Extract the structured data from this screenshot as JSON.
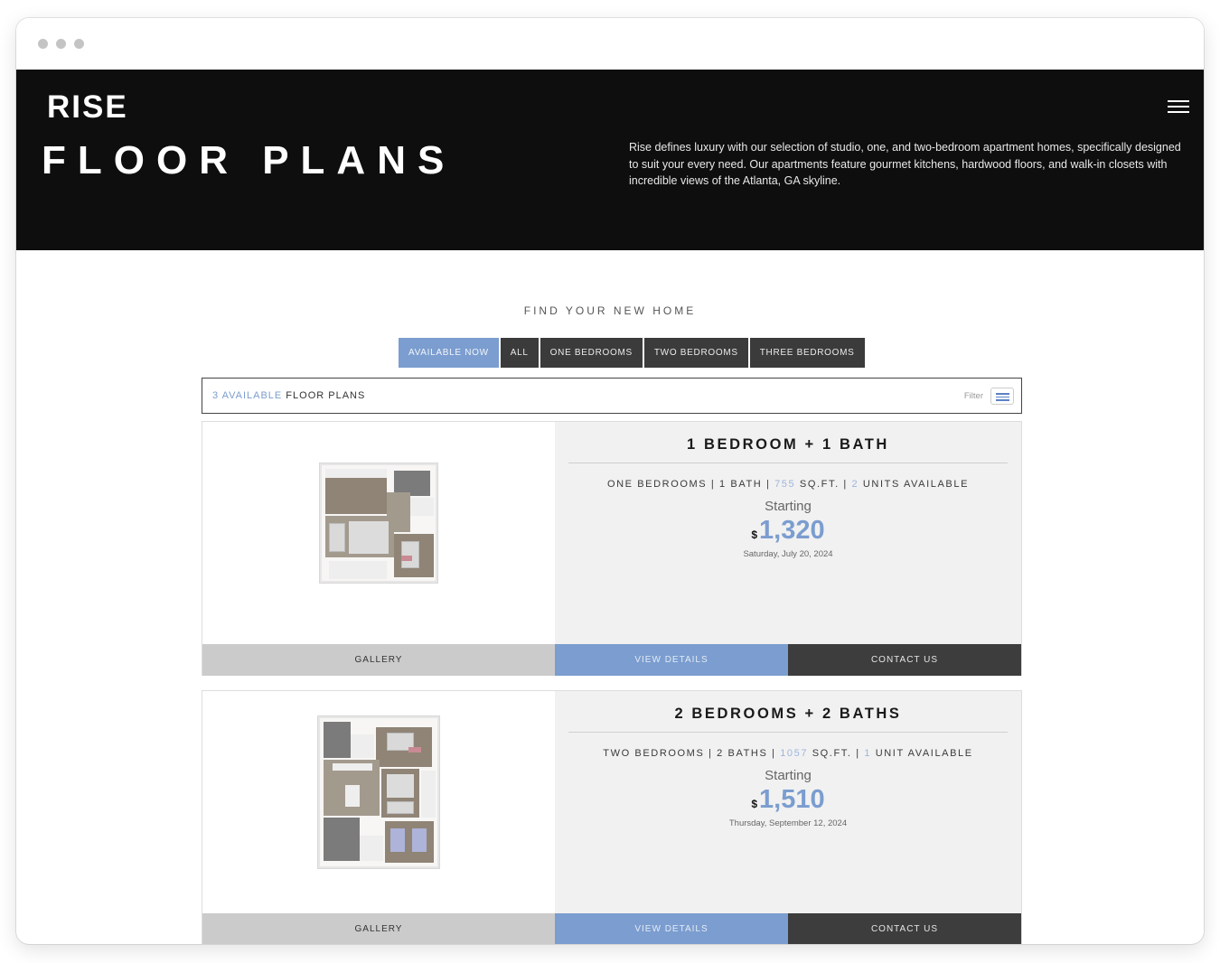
{
  "window": {
    "controls": [
      "close",
      "minimize",
      "maximize"
    ]
  },
  "hero": {
    "brand": "RISE",
    "title": "FLOOR PLANS",
    "description": "Rise defines luxury with our selection of studio, one, and two-bedroom apartment homes, specifically designed to suit your every need. Our apartments feature gourmet kitchens, hardwood floors, and walk-in closets with incredible views of the Atlanta, GA skyline.",
    "menu_icon": "hamburger-icon"
  },
  "search": {
    "heading": "FIND YOUR NEW HOME",
    "tabs": [
      {
        "label": "AVAILABLE NOW",
        "active": true
      },
      {
        "label": "ALL",
        "active": false
      },
      {
        "label": "ONE BEDROOMS",
        "active": false
      },
      {
        "label": "TWO BEDROOMS",
        "active": false
      },
      {
        "label": "THREE BEDROOMS",
        "active": false
      }
    ]
  },
  "results": {
    "count_highlight": "3 AVAILABLE",
    "count_suffix": " FLOOR PLANS",
    "filter_label": "Filter",
    "filter_icon": "list-icon"
  },
  "floorplans": [
    {
      "title": "1 BEDROOM + 1 BATH",
      "type": "ONE BEDROOMS",
      "baths": "1 BATH",
      "sqft": "755",
      "sqft_unit": "SQ.FT.",
      "units": "2",
      "units_label": "UNITS AVAILABLE",
      "starting_label": "Starting",
      "currency": "$",
      "price": "1,320",
      "date": "Saturday, July 20, 2024",
      "actions": {
        "gallery": "GALLERY",
        "details": "VIEW DETAILS",
        "contact": "CONTACT US"
      }
    },
    {
      "title": "2 BEDROOMS + 2 BATHS",
      "type": "TWO BEDROOMS",
      "baths": "2 BATHS",
      "sqft": "1057",
      "sqft_unit": "SQ.FT.",
      "units": "1",
      "units_label": "UNIT AVAILABLE",
      "starting_label": "Starting",
      "currency": "$",
      "price": "1,510",
      "date": "Thursday, September 12, 2024",
      "actions": {
        "gallery": "GALLERY",
        "details": "VIEW DETAILS",
        "contact": "CONTACT US"
      }
    }
  ],
  "colors": {
    "accent": "#7b9dcf",
    "hero_bg": "#0e0e0e",
    "tab_dark": "#3b3b3b",
    "gallery_bg": "#cbcbcb",
    "info_bg": "#f1f1f1"
  }
}
